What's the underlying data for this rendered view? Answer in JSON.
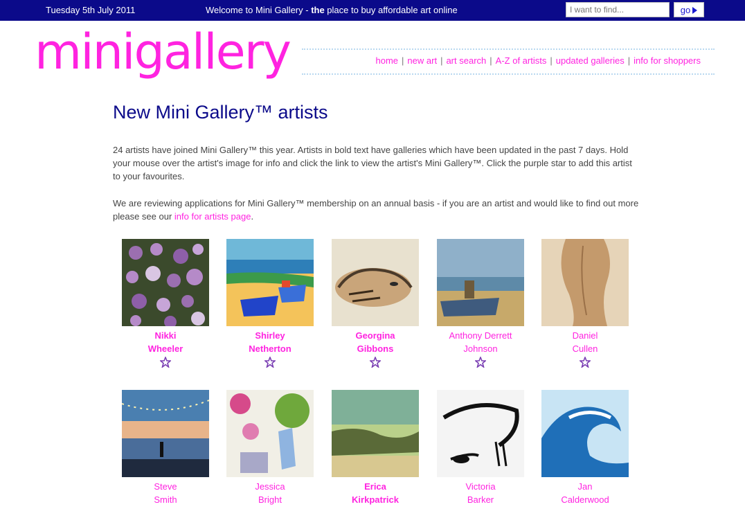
{
  "topbar": {
    "date": "Tuesday 5th July 2011",
    "welcome_pre": "Welcome to Mini Gallery - ",
    "welcome_bold": "the",
    "welcome_post": " place to buy affordable art online",
    "search_placeholder": "I want to find...",
    "go_label": "go"
  },
  "logo": "minigallery",
  "nav": [
    "home",
    "new art",
    "art search",
    "A-Z of artists",
    "updated galleries",
    "info for shoppers"
  ],
  "page_title": "New Mini Gallery™ artists",
  "intro": "24 artists have joined Mini Gallery™ this year. Artists in bold text have galleries which have been updated in the past 7 days. Hold your mouse over the artist's image for info and click the link to view the artist's Mini Gallery™. Click the purple star to add this artist to your favourites.",
  "membership_text": "We are reviewing applications for Mini Gallery™ membership on an annual basis - if you are an artist and would like to find out more please see our ",
  "membership_link": "info for artists page",
  "membership_end": ".",
  "colors": {
    "topbar": "#0b0a8a",
    "accent_pink": "#ff23e0",
    "star_purple": "#7a3fb3"
  },
  "artists": [
    {
      "first": "Nikki",
      "last": "Wheeler",
      "bold": true
    },
    {
      "first": "Shirley",
      "last": "Netherton",
      "bold": true
    },
    {
      "first": "Georgina",
      "last": "Gibbons",
      "bold": true
    },
    {
      "first": "Anthony Derrett",
      "last": "Johnson",
      "bold": false
    },
    {
      "first": "Daniel",
      "last": "Cullen",
      "bold": false
    },
    {
      "first": "Steve",
      "last": "Smith",
      "bold": false
    },
    {
      "first": "Jessica",
      "last": "Bright",
      "bold": false
    },
    {
      "first": "Erica",
      "last": "Kirkpatrick",
      "bold": true
    },
    {
      "first": "Victoria",
      "last": "Barker",
      "bold": false
    },
    {
      "first": "Jan",
      "last": "Calderwood",
      "bold": false
    }
  ]
}
